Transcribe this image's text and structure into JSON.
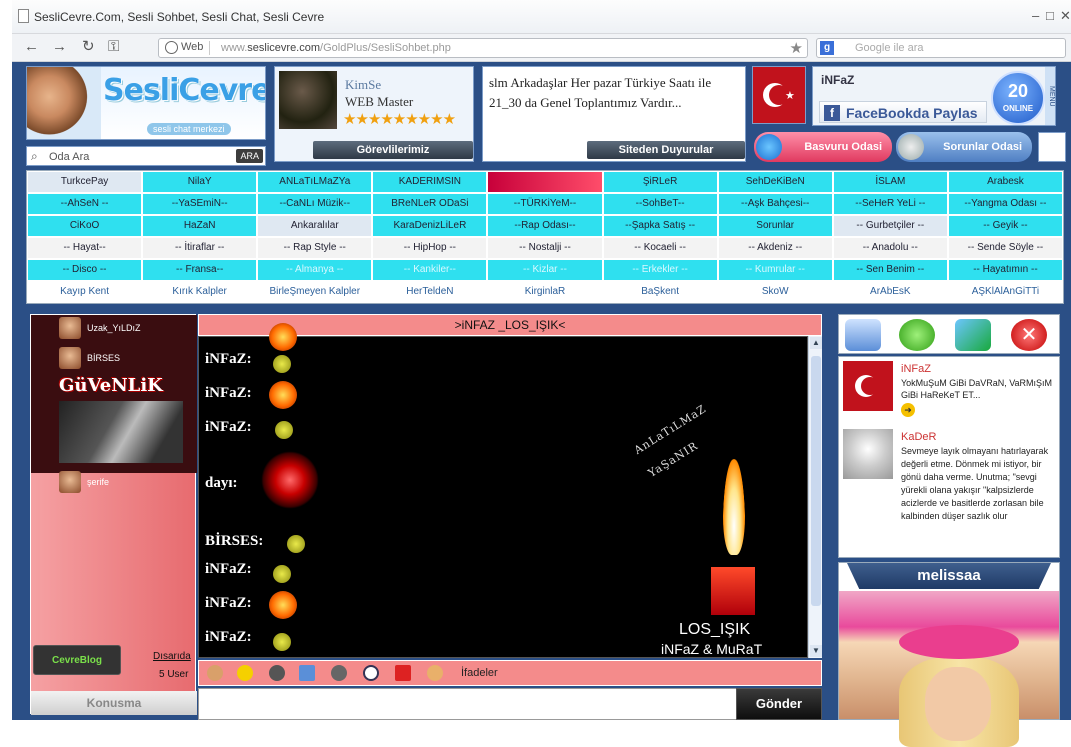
{
  "browser": {
    "tab_title": "SesliCevre.Com, Sesli Sohbet, Sesli Chat, Sesli Cevre",
    "web_label": "Web",
    "url_prefix": "www.",
    "url_domain": "seslicevre.com",
    "url_path": "/GoldPlus/SesliSohbet.php",
    "search_placeholder": "Google ile ara",
    "icons": {
      "back": "arrow-left-icon",
      "forward": "arrow-right-icon",
      "reload": "reload-icon",
      "key": "key-icon",
      "star": "star-icon"
    }
  },
  "header": {
    "logo_text": "SesliCevre",
    "logo_sub": "sesli chat merkezi",
    "search_placeholder": "Oda Ara",
    "search_button": "ARA",
    "master_name": "KimSe",
    "master_role": "WEB Master",
    "master_stars": "★★★★★★★★★",
    "tasks_button": "Görevlilerimiz",
    "announcement": "slm Arkadaşlar Her pazar Türkiye Saatı ile 21_30 da Genel Toplantımız Vardır...",
    "announcement_button": "Siteden Duyurular",
    "current_user": "iNFaZ",
    "facebook_share": "FaceBookda Paylas",
    "online_count": "20",
    "online_label": "ONLINE",
    "menu_label": "MENU",
    "apply_room": "Basvuru Odasi",
    "problems_room": "Sorunlar Odasi",
    "colors": {
      "site_bg": "#2b4f86",
      "room_cyan": "#2fe0ef",
      "chat_header": "#f48b8b",
      "accent_red": "#c1121c"
    }
  },
  "rooms": {
    "rows": [
      [
        "TurkcePay",
        "NilaY",
        "ANLaTıLMaZYa",
        "KADERIMSIN",
        "",
        "ŞiRLeR",
        "SehDeKiBeN",
        "İSLAM",
        "Arabesk"
      ],
      [
        "--AhSeN --",
        "--YaSEmiN--",
        "--CaNLı Müzik--",
        "BReNLeR ODaSi",
        "--TÜRKiYeM--",
        "--SohBeT--",
        "--Aşk Bahçesi--",
        "--SeHeR YeLi --",
        "--Yangma Odası --"
      ],
      [
        "CiKoO",
        "HaZaN",
        "Ankaralılar",
        "KaraDenizLiLeR",
        "--Rap Odası--",
        "--Şapka Satış --",
        "Sorunlar",
        "-- Gurbetçiler --",
        "-- Geyik --"
      ],
      [
        "-- Hayat--",
        "-- İtiraflar --",
        "-- Rap Style --",
        "-- HipHop --",
        "-- Nostalji --",
        "-- Kocaeli --",
        "-- Akdeniz --",
        "-- Anadolu --",
        "-- Sende Söyle --"
      ],
      [
        "-- Disco --",
        "-- Fransa--",
        "-- Almanya --",
        "-- Kankiler--",
        "-- Kizlar --",
        "-- Erkekler --",
        "-- Kumrular --",
        "-- Sen Benim --",
        "-- Hayatımın --"
      ],
      [
        "Kayıp Kent",
        "Kırık Kalpler",
        "BirleŞmeyen Kalpler",
        "HerTeldeN",
        "KirginlaR",
        "BaŞkent",
        "SkoW",
        "ArAbEsK",
        "AŞKlAlAnGiTTi"
      ]
    ]
  },
  "left_panel": {
    "users": [
      {
        "name": "Uzak_YıLDıZ"
      },
      {
        "name": "BİRSES"
      },
      {
        "name": "şerife"
      }
    ],
    "security_label": "GüVeNLiK",
    "logo_label": "CevreBlog",
    "logout_link": "Dısarıda",
    "user_count": "5 User",
    "talk_button": "Konusma"
  },
  "chat": {
    "room_title": ">iNFAZ _LOS_IŞIK<",
    "lines": [
      {
        "user": "iNFaZ:"
      },
      {
        "user": "iNFaZ:"
      },
      {
        "user": "iNFaZ:"
      },
      {
        "user": "dayı:"
      },
      {
        "user": "BİRSES:"
      },
      {
        "user": "iNFaZ:"
      },
      {
        "user": "iNFaZ:"
      },
      {
        "user": "iNFaZ:"
      }
    ],
    "overlay_text_1": "AnLaTıLMaZ",
    "overlay_text_2": "YaŞaNIR",
    "overlay_text_3": "LOS_IŞIK",
    "overlay_text_4": "iNFaZ & MuRaT",
    "emoji_label": "İfadeler",
    "send_button": "Gönder"
  },
  "right_panel": {
    "messages": [
      {
        "name": "iNFaZ",
        "text": "YokMuŞuM GiBi DaVRaN, VaRMıŞıM GiBi HaReKeT ET..."
      },
      {
        "name": "KaDeR",
        "text": "Sevmeye layık olmayanı hatırlayarak değerli etme. Dönmek mi istiyor, bir gönü daha verme. Unutma; \"sevgi yürekli olana yakışır \"kalpsizlerde acizlerde ve basitlerde zorlasan bile kalbinden düşer sazlık olur"
      }
    ],
    "profile_name": "melissaa"
  }
}
